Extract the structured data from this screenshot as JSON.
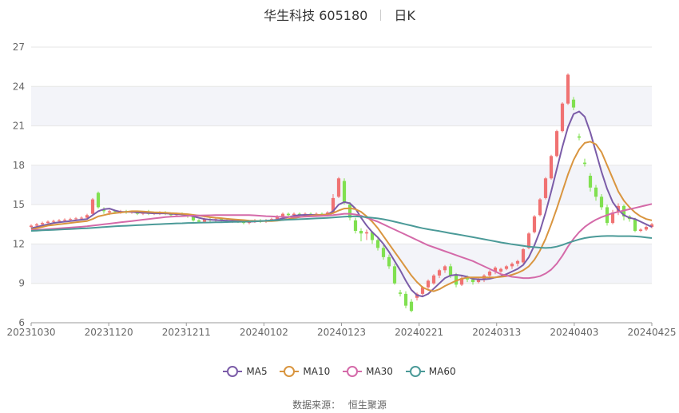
{
  "header": {
    "title": "华生科技 605180",
    "period": "日K"
  },
  "source": {
    "label": "数据来源：",
    "value": "恒生聚源"
  },
  "colors": {
    "up": "#f07272",
    "down": "#80e050",
    "MA5": "#7b5ca8",
    "MA10": "#d9953f",
    "MA30": "#d46aa9",
    "MA60": "#4b9a98",
    "band": "#f3f4f9",
    "grid": "#e6e6e6",
    "axis_text": "#666666"
  },
  "chart_data": {
    "type": "candlestick",
    "ylim": [
      6,
      27
    ],
    "yticks": [
      6,
      9,
      12,
      15,
      18,
      21,
      24,
      27
    ],
    "x_ticks": [
      "20231030",
      "20231120",
      "20231211",
      "20240102",
      "20240123",
      "20240221",
      "20240313",
      "20240403",
      "20240425"
    ],
    "grid": true,
    "legend_position": "bottom",
    "candles": [
      [
        13.3,
        13.4,
        13.5,
        13.2
      ],
      [
        13.4,
        13.5,
        13.6,
        13.3
      ],
      [
        13.5,
        13.6,
        13.7,
        13.4
      ],
      [
        13.6,
        13.7,
        13.8,
        13.5
      ],
      [
        13.7,
        13.75,
        13.85,
        13.6
      ],
      [
        13.75,
        13.8,
        13.9,
        13.65
      ],
      [
        13.8,
        13.85,
        13.95,
        13.7
      ],
      [
        13.85,
        13.9,
        14.0,
        13.75
      ],
      [
        13.9,
        13.95,
        14.05,
        13.8
      ],
      [
        13.95,
        14.0,
        14.1,
        13.85
      ],
      [
        14.0,
        14.2,
        14.3,
        13.9
      ],
      [
        14.3,
        15.4,
        15.5,
        14.2
      ],
      [
        15.9,
        14.8,
        16.0,
        14.7
      ],
      [
        14.6,
        14.5,
        14.8,
        14.3
      ],
      [
        14.4,
        14.5,
        14.6,
        14.2
      ],
      [
        14.5,
        14.45,
        14.6,
        14.3
      ],
      [
        14.4,
        14.5,
        14.6,
        14.3
      ],
      [
        14.5,
        14.4,
        14.6,
        14.3
      ],
      [
        14.4,
        14.45,
        14.55,
        14.3
      ],
      [
        14.45,
        14.3,
        14.55,
        14.2
      ],
      [
        14.3,
        14.4,
        14.5,
        14.2
      ],
      [
        14.4,
        14.3,
        14.6,
        14.2
      ],
      [
        14.3,
        14.35,
        14.45,
        14.2
      ],
      [
        14.3,
        14.4,
        14.5,
        14.2
      ],
      [
        14.4,
        14.3,
        14.5,
        14.2
      ],
      [
        14.3,
        14.2,
        14.4,
        14.1
      ],
      [
        14.2,
        14.3,
        14.4,
        14.1
      ],
      [
        14.3,
        14.2,
        14.4,
        14.1
      ],
      [
        14.2,
        14.1,
        14.3,
        14.0
      ],
      [
        14.1,
        13.8,
        14.2,
        13.7
      ],
      [
        13.8,
        13.7,
        13.9,
        13.6
      ],
      [
        13.7,
        13.9,
        14.0,
        13.6
      ],
      [
        13.9,
        13.8,
        14.0,
        13.7
      ],
      [
        13.8,
        13.9,
        14.0,
        13.7
      ],
      [
        13.9,
        13.8,
        14.0,
        13.7
      ],
      [
        13.8,
        13.7,
        13.9,
        13.6
      ],
      [
        13.7,
        13.8,
        13.9,
        13.6
      ],
      [
        13.8,
        13.7,
        13.9,
        13.6
      ],
      [
        13.7,
        13.6,
        13.8,
        13.5
      ],
      [
        13.6,
        13.7,
        13.8,
        13.5
      ],
      [
        13.7,
        13.8,
        13.9,
        13.6
      ],
      [
        13.8,
        13.7,
        13.9,
        13.6
      ],
      [
        13.7,
        13.8,
        13.9,
        13.6
      ],
      [
        13.8,
        13.9,
        14.0,
        13.7
      ],
      [
        13.9,
        14.1,
        14.2,
        13.8
      ],
      [
        14.1,
        14.3,
        14.4,
        14.0
      ],
      [
        14.3,
        14.2,
        14.4,
        14.1
      ],
      [
        14.2,
        14.3,
        14.4,
        14.1
      ],
      [
        14.3,
        14.2,
        14.4,
        14.1
      ],
      [
        14.2,
        14.3,
        14.4,
        14.1
      ],
      [
        14.3,
        14.2,
        14.4,
        14.1
      ],
      [
        14.2,
        14.3,
        14.4,
        14.1
      ],
      [
        14.3,
        14.2,
        14.4,
        14.1
      ],
      [
        14.2,
        14.4,
        14.5,
        14.1
      ],
      [
        14.4,
        15.5,
        15.8,
        14.3
      ],
      [
        15.6,
        17.0,
        17.1,
        15.5
      ],
      [
        16.8,
        15.2,
        17.0,
        15.0
      ],
      [
        15.0,
        14.0,
        15.2,
        13.8
      ],
      [
        13.8,
        13.0,
        14.0,
        12.8
      ],
      [
        13.0,
        12.8,
        13.2,
        12.2
      ],
      [
        12.8,
        12.9,
        13.1,
        12.3
      ],
      [
        12.9,
        12.3,
        13.0,
        12.0
      ],
      [
        12.3,
        11.7,
        12.5,
        11.5
      ],
      [
        11.7,
        11.0,
        11.9,
        10.8
      ],
      [
        11.0,
        10.3,
        11.2,
        10.1
      ],
      [
        10.3,
        9.0,
        10.5,
        8.9
      ],
      [
        8.3,
        8.2,
        8.5,
        8.0
      ],
      [
        8.2,
        7.3,
        8.4,
        7.1
      ],
      [
        7.6,
        6.9,
        7.8,
        6.8
      ],
      [
        7.9,
        8.2,
        8.3,
        7.7
      ],
      [
        8.2,
        8.7,
        8.8,
        8.0
      ],
      [
        8.7,
        9.2,
        9.3,
        8.5
      ],
      [
        9.0,
        9.6,
        9.7,
        8.9
      ],
      [
        9.6,
        10.0,
        10.1,
        9.4
      ],
      [
        10.0,
        10.3,
        10.4,
        9.8
      ],
      [
        10.3,
        9.6,
        10.5,
        9.4
      ],
      [
        9.6,
        8.9,
        9.8,
        8.7
      ],
      [
        8.9,
        9.4,
        9.6,
        8.8
      ],
      [
        9.4,
        9.3,
        9.6,
        9.1
      ],
      [
        9.3,
        9.1,
        9.5,
        8.9
      ],
      [
        9.1,
        9.3,
        9.5,
        9.0
      ],
      [
        9.3,
        9.6,
        9.7,
        9.1
      ],
      [
        9.6,
        9.9,
        10.0,
        9.4
      ],
      [
        9.9,
        10.2,
        10.3,
        9.7
      ],
      [
        9.9,
        10.1,
        10.2,
        9.8
      ],
      [
        10.1,
        10.3,
        10.4,
        10.0
      ],
      [
        10.3,
        10.5,
        10.6,
        10.1
      ],
      [
        10.5,
        10.7,
        10.8,
        10.3
      ],
      [
        10.6,
        11.6,
        11.7,
        10.5
      ],
      [
        11.7,
        12.8,
        12.9,
        11.6
      ],
      [
        12.9,
        14.1,
        14.2,
        12.8
      ],
      [
        14.2,
        15.4,
        15.5,
        14.1
      ],
      [
        15.5,
        17.0,
        17.1,
        15.4
      ],
      [
        17.0,
        18.7,
        18.8,
        16.9
      ],
      [
        18.7,
        20.6,
        20.7,
        18.6
      ],
      [
        20.6,
        22.7,
        22.8,
        20.5
      ],
      [
        22.7,
        24.9,
        25.0,
        22.6
      ],
      [
        23.0,
        22.4,
        23.2,
        22.2
      ],
      [
        20.2,
        20.1,
        20.4,
        19.9
      ],
      [
        18.2,
        18.1,
        18.5,
        17.9
      ],
      [
        17.2,
        16.3,
        17.4,
        16.0
      ],
      [
        16.3,
        15.6,
        16.5,
        15.3
      ],
      [
        15.6,
        14.8,
        15.8,
        14.6
      ],
      [
        14.8,
        13.6,
        15.0,
        13.4
      ],
      [
        13.6,
        14.4,
        14.6,
        13.5
      ],
      [
        14.4,
        14.9,
        15.1,
        14.2
      ],
      [
        14.9,
        14.1,
        15.0,
        13.8
      ],
      [
        14.1,
        13.9,
        14.2,
        13.7
      ],
      [
        13.9,
        13.0,
        14.0,
        12.9
      ],
      [
        13.0,
        13.1,
        13.2,
        12.9
      ],
      [
        13.1,
        13.3,
        13.4,
        13.0
      ],
      [
        13.3,
        13.5,
        13.6,
        13.2
      ]
    ],
    "series": [
      {
        "name": "MA5",
        "values": [
          13.2,
          13.3,
          13.4,
          13.5,
          13.6,
          13.65,
          13.7,
          13.75,
          13.8,
          13.85,
          13.9,
          14.2,
          14.5,
          14.65,
          14.7,
          14.55,
          14.45,
          14.45,
          14.45,
          14.4,
          14.38,
          14.36,
          14.33,
          14.33,
          14.33,
          14.3,
          14.28,
          14.26,
          14.2,
          14.1,
          14.0,
          13.9,
          13.85,
          13.82,
          13.8,
          13.78,
          13.76,
          13.74,
          13.72,
          13.7,
          13.72,
          13.74,
          13.77,
          13.8,
          13.85,
          13.95,
          14.05,
          14.15,
          14.2,
          14.22,
          14.22,
          14.22,
          14.22,
          14.25,
          14.5,
          15.0,
          15.2,
          15.1,
          14.7,
          14.0,
          13.4,
          12.9,
          12.5,
          12.0,
          11.4,
          10.7,
          10.0,
          9.2,
          8.5,
          8.1,
          8.0,
          8.2,
          8.6,
          9.0,
          9.4,
          9.6,
          9.65,
          9.6,
          9.5,
          9.35,
          9.3,
          9.3,
          9.35,
          9.45,
          9.55,
          9.7,
          9.9,
          10.1,
          10.4,
          11.0,
          11.9,
          13.0,
          14.4,
          16.0,
          17.7,
          19.4,
          20.9,
          21.9,
          22.1,
          21.7,
          20.5,
          19.0,
          17.5,
          16.2,
          15.2,
          14.6,
          14.2,
          14.0,
          13.9,
          13.7,
          13.5,
          13.3
        ]
      },
      {
        "name": "MA10",
        "values": [
          13.1,
          13.2,
          13.3,
          13.4,
          13.45,
          13.5,
          13.55,
          13.6,
          13.65,
          13.7,
          13.75,
          13.9,
          14.1,
          14.2,
          14.3,
          14.35,
          14.4,
          14.45,
          14.5,
          14.5,
          14.48,
          14.45,
          14.42,
          14.4,
          14.38,
          14.35,
          14.33,
          14.3,
          14.27,
          14.22,
          14.16,
          14.1,
          14.04,
          14.0,
          13.97,
          13.92,
          13.88,
          13.85,
          13.82,
          13.78,
          13.76,
          13.74,
          13.74,
          13.75,
          13.78,
          13.83,
          13.9,
          13.98,
          14.05,
          14.1,
          14.15,
          14.2,
          14.22,
          14.25,
          14.35,
          14.55,
          14.7,
          14.72,
          14.65,
          14.45,
          14.1,
          13.7,
          13.2,
          12.6,
          12.0,
          11.4,
          10.8,
          10.2,
          9.6,
          9.1,
          8.7,
          8.5,
          8.4,
          8.55,
          8.8,
          9.0,
          9.2,
          9.35,
          9.45,
          9.45,
          9.45,
          9.45,
          9.45,
          9.45,
          9.5,
          9.55,
          9.65,
          9.8,
          10.0,
          10.3,
          10.8,
          11.5,
          12.4,
          13.5,
          14.7,
          16.0,
          17.3,
          18.4,
          19.2,
          19.7,
          19.8,
          19.6,
          19.0,
          18.0,
          17.0,
          16.0,
          15.3,
          14.8,
          14.4,
          14.1,
          13.9,
          13.8
        ]
      },
      {
        "name": "MA30",
        "values": [
          13.05,
          13.08,
          13.1,
          13.13,
          13.16,
          13.19,
          13.22,
          13.25,
          13.28,
          13.31,
          13.35,
          13.4,
          13.45,
          13.5,
          13.55,
          13.6,
          13.65,
          13.7,
          13.75,
          13.8,
          13.85,
          13.9,
          13.95,
          14.0,
          14.05,
          14.08,
          14.1,
          14.12,
          14.14,
          14.16,
          14.17,
          14.18,
          14.19,
          14.2,
          14.2,
          14.2,
          14.2,
          14.2,
          14.2,
          14.2,
          14.18,
          14.15,
          14.12,
          14.1,
          14.08,
          14.07,
          14.06,
          14.06,
          14.07,
          14.08,
          14.1,
          14.12,
          14.14,
          14.16,
          14.2,
          14.25,
          14.3,
          14.3,
          14.25,
          14.15,
          14.0,
          13.85,
          13.7,
          13.5,
          13.3,
          13.1,
          12.9,
          12.7,
          12.5,
          12.3,
          12.1,
          11.9,
          11.75,
          11.6,
          11.45,
          11.3,
          11.15,
          11.0,
          10.85,
          10.7,
          10.5,
          10.3,
          10.1,
          9.9,
          9.7,
          9.6,
          9.5,
          9.45,
          9.4,
          9.4,
          9.45,
          9.55,
          9.75,
          10.05,
          10.5,
          11.1,
          11.8,
          12.4,
          12.9,
          13.3,
          13.6,
          13.85,
          14.05,
          14.2,
          14.35,
          14.45,
          14.55,
          14.65,
          14.75,
          14.85,
          14.95,
          15.05
        ]
      },
      {
        "name": "MA60",
        "values": [
          13.0,
          13.02,
          13.04,
          13.06,
          13.08,
          13.1,
          13.12,
          13.14,
          13.16,
          13.18,
          13.2,
          13.23,
          13.26,
          13.29,
          13.32,
          13.35,
          13.37,
          13.39,
          13.41,
          13.43,
          13.45,
          13.47,
          13.49,
          13.51,
          13.53,
          13.55,
          13.57,
          13.58,
          13.6,
          13.61,
          13.62,
          13.63,
          13.64,
          13.65,
          13.66,
          13.67,
          13.68,
          13.69,
          13.7,
          13.71,
          13.73,
          13.75,
          13.77,
          13.79,
          13.81,
          13.83,
          13.85,
          13.87,
          13.89,
          13.91,
          13.93,
          13.95,
          13.97,
          13.99,
          14.02,
          14.05,
          14.08,
          14.1,
          14.1,
          14.08,
          14.04,
          14.0,
          13.95,
          13.88,
          13.8,
          13.7,
          13.6,
          13.5,
          13.4,
          13.3,
          13.2,
          13.12,
          13.05,
          12.98,
          12.9,
          12.82,
          12.75,
          12.68,
          12.6,
          12.52,
          12.44,
          12.36,
          12.28,
          12.2,
          12.12,
          12.05,
          11.98,
          11.92,
          11.86,
          11.8,
          11.76,
          11.72,
          11.7,
          11.72,
          11.8,
          11.92,
          12.08,
          12.22,
          12.35,
          12.45,
          12.52,
          12.57,
          12.6,
          12.61,
          12.61,
          12.6,
          12.6,
          12.6,
          12.58,
          12.55,
          12.5,
          12.45
        ]
      }
    ]
  }
}
